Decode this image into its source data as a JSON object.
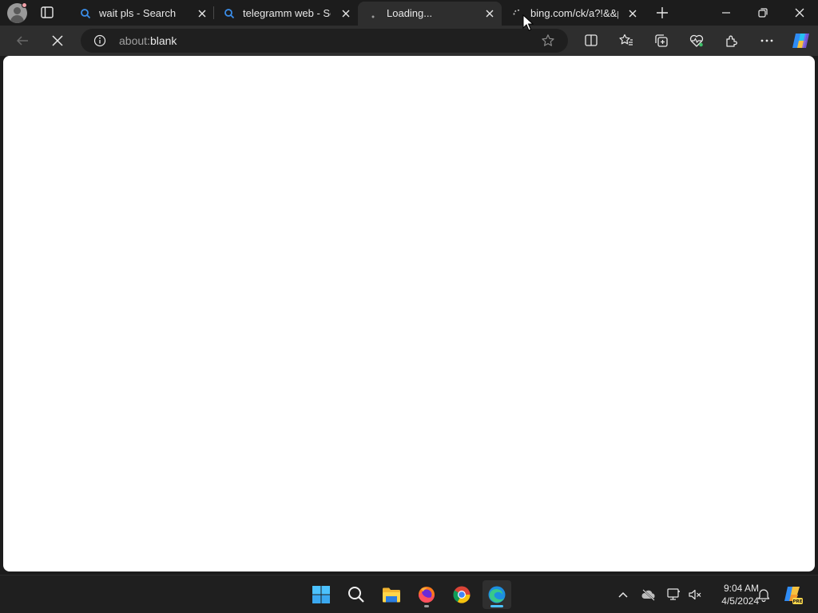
{
  "browser": {
    "tabs": [
      {
        "title": "wait pls - Search",
        "icon": "search-icon",
        "active": false
      },
      {
        "title": "telegramm web - Search",
        "icon": "search-icon",
        "active": false
      },
      {
        "title": "Loading...",
        "icon": "loading-icon",
        "active": true
      },
      {
        "title": "bing.com/ck/a?!&&p=",
        "icon": "loading-spinner-icon",
        "active": false
      }
    ],
    "address": {
      "scheme": "about:",
      "rest": "blank"
    }
  },
  "taskbar": {
    "apps": [
      "start-button",
      "search-button",
      "file-explorer",
      "firefox",
      "chrome",
      "edge"
    ],
    "clock": {
      "time": "9:04 AM",
      "date": "4/5/2024"
    }
  },
  "colors": {
    "accent": "#4cc2ff",
    "titlebar": "#1c1c1c",
    "toolbar": "#2e2e2e"
  }
}
